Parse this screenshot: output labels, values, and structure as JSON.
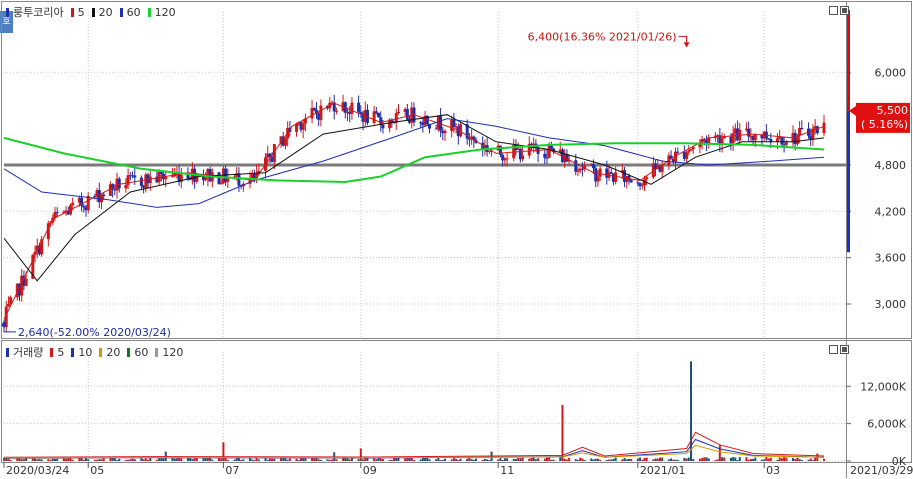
{
  "side_badge": "호",
  "price_panel": {
    "legend": {
      "name": "룽투코리아",
      "ma": [
        {
          "label": "5",
          "color": "#d01818"
        },
        {
          "label": "20",
          "color": "#111111"
        },
        {
          "label": "60",
          "color": "#1e2fb0"
        },
        {
          "label": "120",
          "color": "#19d12a"
        }
      ]
    },
    "current_price": "5,500",
    "current_change": "( 5.16%)",
    "high_annotation": "6,400(16.36% 2021/01/26)",
    "low_annotation": "2,640(-52.00% 2020/03/24)"
  },
  "volume_panel": {
    "legend": {
      "name": "거래량",
      "ma": [
        {
          "label": "5",
          "color": "#d01818"
        },
        {
          "label": "10",
          "color": "#1e2fb0"
        },
        {
          "label": "20",
          "color": "#d09a00"
        },
        {
          "label": "60",
          "color": "#0b7a1a"
        },
        {
          "label": "120",
          "color": "#9a9a9a"
        }
      ]
    }
  },
  "chart_data": [
    {
      "type": "candlestick",
      "title": "룽투코리아",
      "y_ticks": [
        "6,000",
        "4,800",
        "4,200",
        "3,600",
        "3,000"
      ],
      "ylim": [
        2560,
        6780
      ],
      "reference_line": 4800,
      "current": {
        "price": 5500,
        "change_pct": 5.16
      },
      "high": {
        "price": 6400,
        "change_pct": 16.36,
        "date": "2021/01/26"
      },
      "low": {
        "price": 2640,
        "change_pct": -52.0,
        "date": "2020/03/24"
      },
      "x_labels": [
        "2020/03/24",
        "05",
        "07",
        "09",
        "11",
        "2021/01",
        "03",
        "2021/03/29"
      ],
      "x_label_dates": [
        "2020-03-24",
        "2020-05-01",
        "2020-07-01",
        "2020-09-01",
        "2020-11-02",
        "2021-01-04",
        "2021-03-02",
        "2021-03-29"
      ],
      "range": {
        "start": "2020-03-24",
        "end": "2021-03-29"
      },
      "series": [
        {
          "name": "5",
          "color": "#d01818",
          "points": [
            [
              "2020-03-24",
              2800
            ],
            [
              "2020-04-15",
              4100
            ],
            [
              "2020-05-15",
              4550
            ],
            [
              "2020-06-15",
              4700
            ],
            [
              "2020-07-15",
              4600
            ],
            [
              "2020-08-01",
              5300
            ],
            [
              "2020-08-20",
              5600
            ],
            [
              "2020-09-10",
              5350
            ],
            [
              "2020-09-25",
              5450
            ],
            [
              "2020-10-15",
              5250
            ],
            [
              "2020-11-01",
              4950
            ],
            [
              "2020-11-25",
              5000
            ],
            [
              "2020-12-15",
              4700
            ],
            [
              "2021-01-05",
              4600
            ],
            [
              "2021-01-20",
              4900
            ],
            [
              "2021-02-05",
              5150
            ],
            [
              "2021-02-25",
              5200
            ],
            [
              "2021-03-15",
              5150
            ],
            [
              "2021-03-29",
              5300
            ]
          ]
        },
        {
          "name": "20",
          "color": "#111111",
          "points": [
            [
              "2020-03-24",
              3850
            ],
            [
              "2020-04-08",
              3300
            ],
            [
              "2020-04-25",
              3900
            ],
            [
              "2020-05-20",
              4450
            ],
            [
              "2020-06-20",
              4650
            ],
            [
              "2020-07-20",
              4700
            ],
            [
              "2020-08-15",
              5200
            ],
            [
              "2020-09-15",
              5350
            ],
            [
              "2020-10-10",
              5450
            ],
            [
              "2020-11-01",
              5100
            ],
            [
              "2020-11-25",
              5000
            ],
            [
              "2020-12-20",
              4800
            ],
            [
              "2021-01-10",
              4550
            ],
            [
              "2021-01-30",
              4900
            ],
            [
              "2021-02-20",
              5100
            ],
            [
              "2021-03-15",
              5100
            ],
            [
              "2021-03-29",
              5150
            ]
          ]
        },
        {
          "name": "60",
          "color": "#1e2fb0",
          "points": [
            [
              "2020-03-24",
              4750
            ],
            [
              "2020-04-10",
              4450
            ],
            [
              "2020-05-10",
              4350
            ],
            [
              "2020-06-01",
              4250
            ],
            [
              "2020-06-20",
              4300
            ],
            [
              "2020-07-15",
              4600
            ],
            [
              "2020-08-15",
              4850
            ],
            [
              "2020-09-15",
              5150
            ],
            [
              "2020-10-10",
              5400
            ],
            [
              "2020-11-01",
              5300
            ],
            [
              "2020-11-25",
              5150
            ],
            [
              "2020-12-20",
              5050
            ],
            [
              "2021-01-15",
              4850
            ],
            [
              "2021-02-05",
              4800
            ],
            [
              "2021-03-05",
              4850
            ],
            [
              "2021-03-29",
              4900
            ]
          ]
        },
        {
          "name": "120",
          "color": "#19d12a",
          "points": [
            [
              "2020-03-24",
              5150
            ],
            [
              "2020-04-20",
              4950
            ],
            [
              "2020-05-25",
              4750
            ],
            [
              "2020-06-25",
              4650
            ],
            [
              "2020-07-25",
              4600
            ],
            [
              "2020-08-25",
              4580
            ],
            [
              "2020-09-10",
              4650
            ],
            [
              "2020-09-30",
              4900
            ],
            [
              "2020-10-25",
              5000
            ],
            [
              "2020-11-25",
              5060
            ],
            [
              "2020-12-25",
              5080
            ],
            [
              "2021-01-25",
              5080
            ],
            [
              "2021-02-25",
              5060
            ],
            [
              "2021-03-29",
              5000
            ]
          ]
        }
      ]
    },
    {
      "type": "bar",
      "title": "거래량",
      "y_ticks": [
        "12,000K",
        "6,000K",
        "0K"
      ],
      "ylim": [
        0,
        17500
      ],
      "bars": [
        [
          "2020-06-05",
          1500
        ],
        [
          "2020-07-01",
          3000
        ],
        [
          "2020-07-25",
          2200
        ],
        [
          "2020-08-20",
          1400
        ],
        [
          "2020-09-01",
          2000
        ],
        [
          "2020-10-30",
          1500
        ],
        [
          "2020-12-01",
          9000
        ],
        [
          "2021-01-28",
          16000
        ],
        [
          "2021-01-30",
          4500
        ],
        [
          "2021-02-10",
          2500
        ],
        [
          "2021-03-26",
          1200
        ]
      ],
      "base_level": 350
    }
  ]
}
